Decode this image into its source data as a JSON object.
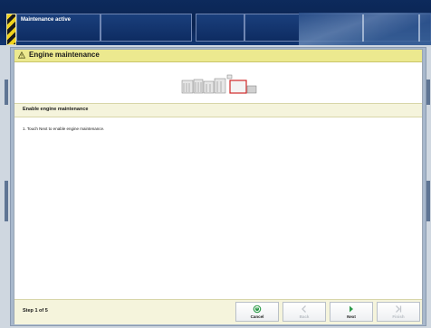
{
  "status_bar": {
    "title": "Maintenance active"
  },
  "dialog": {
    "title": "Engine maintenance",
    "section_title": "Enable engine maintenance",
    "instruction": "1. Touch Next to enable engine maintenance."
  },
  "footer": {
    "step": "Step 1 of 5",
    "buttons": {
      "cancel": "Cancel",
      "back": "Back",
      "next": "Next",
      "finish": "Finish"
    }
  },
  "colors": {
    "header_bg": "#ece98f",
    "section_bg": "#f5f4dc",
    "topbar_bg": "#0d2a5c",
    "cancel_icon": "#2e9b4a",
    "next_icon": "#2e9b4a",
    "highlight_step": "#d02828"
  },
  "icons": {
    "header": "warning-icon",
    "cancel": "cancel-icon",
    "back": "chevron-left-icon",
    "next": "chevron-right-icon",
    "finish": "finish-icon"
  }
}
